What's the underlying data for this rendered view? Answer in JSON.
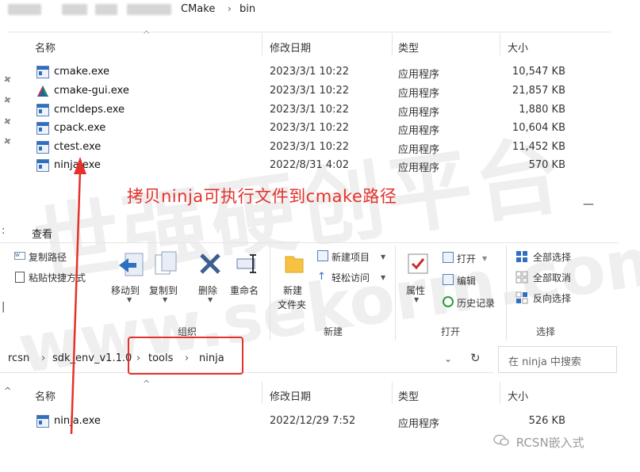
{
  "breadcrumb_top": {
    "items": [
      "CMake",
      "bin"
    ],
    "separator": "›"
  },
  "columns": {
    "name": "名称",
    "date": "修改日期",
    "type": "类型",
    "size": "大小"
  },
  "top_files": [
    {
      "name": "cmake.exe",
      "date": "2023/3/1 10:22",
      "type": "应用程序",
      "size": "10,547 KB",
      "icon": "exe-icon"
    },
    {
      "name": "cmake-gui.exe",
      "date": "2023/3/1 10:22",
      "type": "应用程序",
      "size": "21,857 KB",
      "icon": "cmake-logo-icon"
    },
    {
      "name": "cmcldeps.exe",
      "date": "2023/3/1 10:22",
      "type": "应用程序",
      "size": "1,880 KB",
      "icon": "exe-icon"
    },
    {
      "name": "cpack.exe",
      "date": "2023/3/1 10:22",
      "type": "应用程序",
      "size": "10,604 KB",
      "icon": "exe-icon"
    },
    {
      "name": "ctest.exe",
      "date": "2023/3/1 10:22",
      "type": "应用程序",
      "size": "11,452 KB",
      "icon": "exe-icon"
    },
    {
      "name": "ninja.exe",
      "date": "2022/8/31 4:02",
      "type": "应用程序",
      "size": "570 KB",
      "icon": "exe-icon"
    }
  ],
  "annotation": "拷贝ninja可执行文件到cmake路径",
  "ribbon": {
    "tab": "查看",
    "copy_path": "复制路径",
    "paste_shortcut": "粘贴快捷方式",
    "move_to": "移动到",
    "copy_to": "复制到",
    "delete": "删除",
    "rename": "重命名",
    "new_folder_line1": "新建",
    "new_folder_line2": "文件夹",
    "new_item": "新建项目",
    "easy_access": "轻松访问",
    "properties": "属性",
    "open": "打开",
    "edit": "编辑",
    "history": "历史记录",
    "select_all": "全部选择",
    "select_none": "全部取消",
    "invert_selection": "反向选择",
    "groups": {
      "organize": "组织",
      "new": "新建",
      "open": "打开",
      "select": "选择"
    }
  },
  "address": {
    "items": [
      "rcsn",
      "sdk_env_v1.1.0",
      "tools",
      "ninja"
    ],
    "separator": "›",
    "search_placeholder": "在 ninja 中搜索"
  },
  "bottom_files": [
    {
      "name": "ninja.exe",
      "date": "2022/12/29 7:52",
      "type": "应用程序",
      "size": "526 KB",
      "icon": "exe-icon"
    }
  ],
  "wechat_label": "RCSN嵌入式",
  "watermark": {
    "line1": "世强硬创平台",
    "line2": "www.sekorm.com"
  },
  "colors": {
    "annotation_red": "#e4322b",
    "exe_blue": "#2f6fbf"
  }
}
